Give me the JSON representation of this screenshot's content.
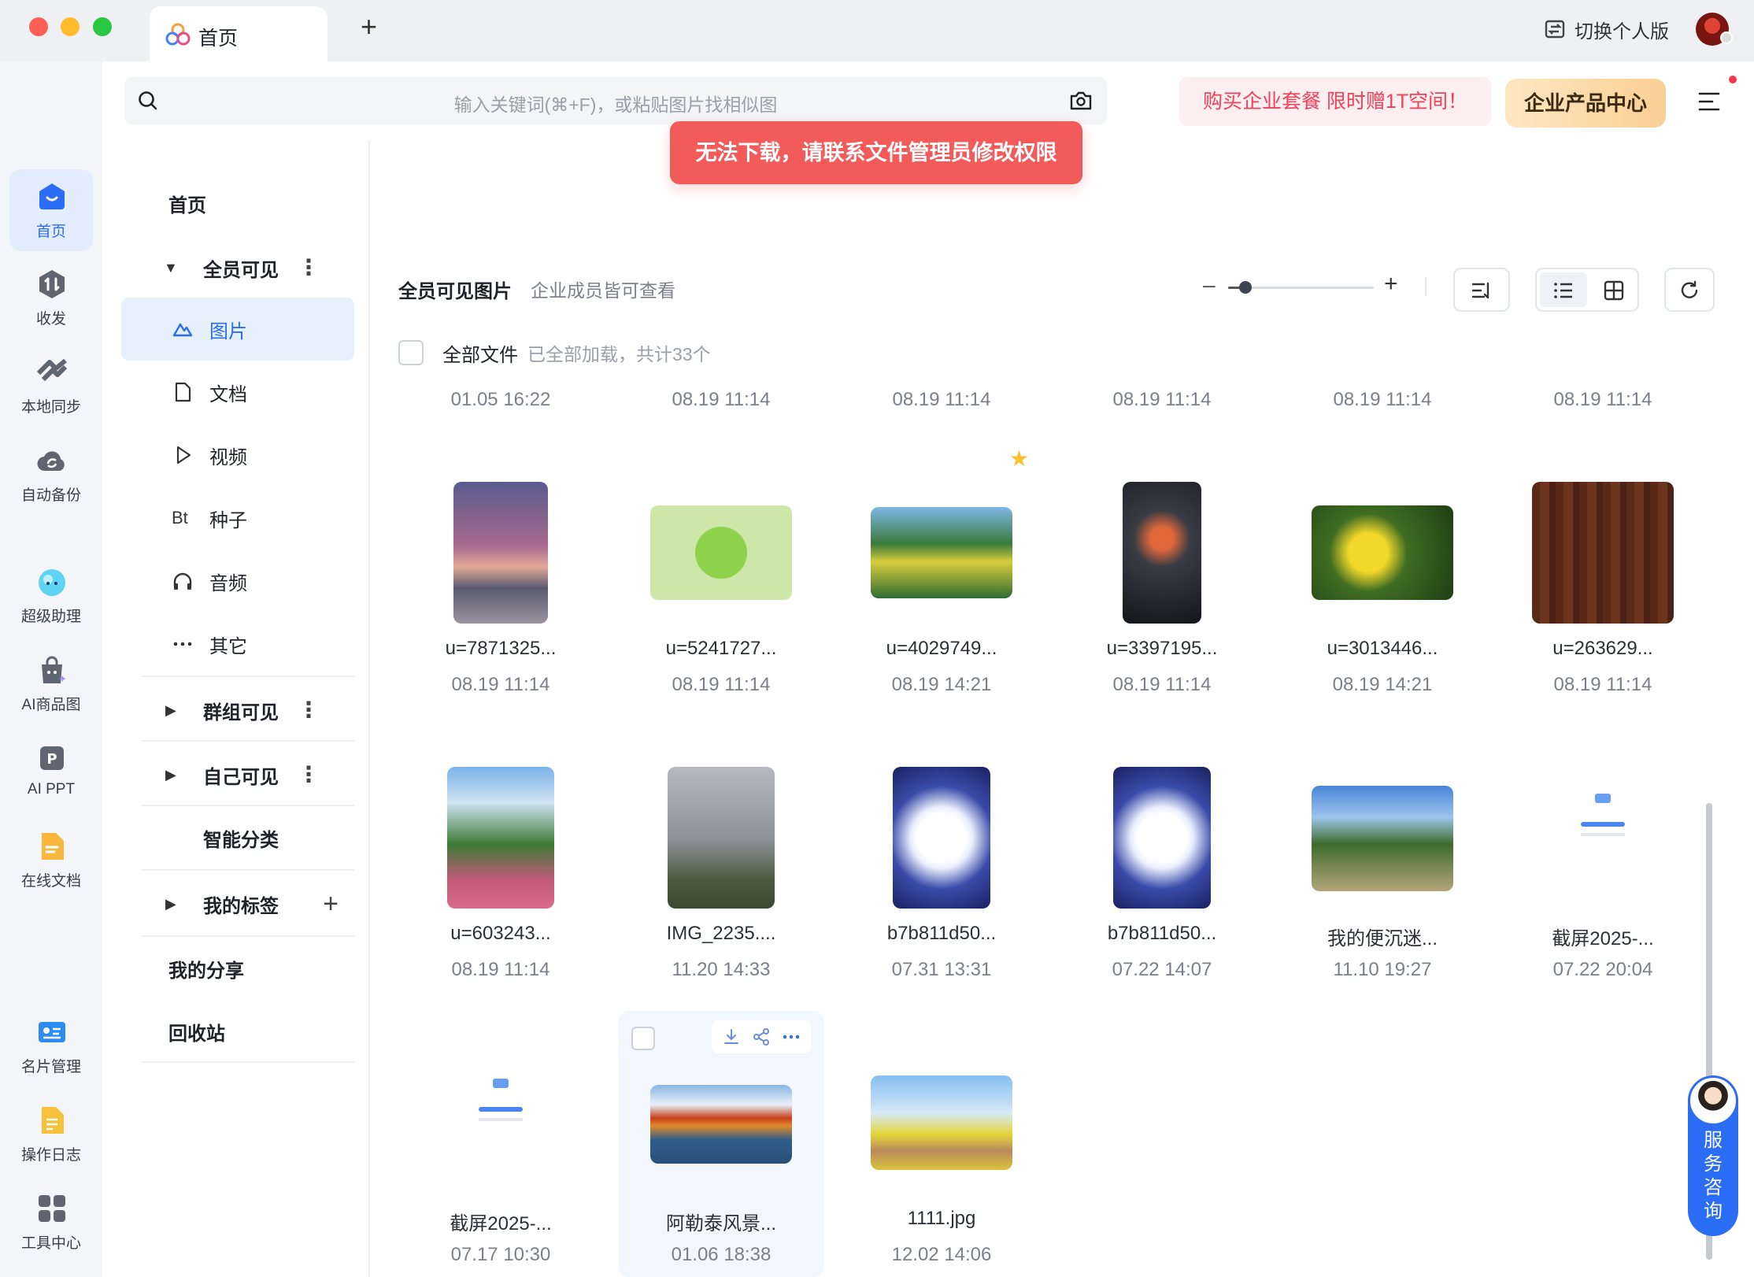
{
  "tab": {
    "label": "首页",
    "add": "+"
  },
  "titlebar": {
    "switch_label": "切换个人版"
  },
  "search": {
    "placeholder": "输入关键词(⌘+F)，或粘贴图片找相似图"
  },
  "promo": "购买企业套餐 限时赠1T空间！",
  "product_center": "企业产品中心",
  "toast": "无法下载，请联系文件管理员修改权限",
  "rail": [
    {
      "label": "首页",
      "icon": "home-icon"
    },
    {
      "label": "收发",
      "icon": "transfer-icon"
    },
    {
      "label": "本地同步",
      "icon": "sync-icon"
    },
    {
      "label": "自动备份",
      "icon": "backup-icon"
    },
    {
      "label": "超级助理",
      "icon": "assistant-icon"
    },
    {
      "label": "AI商品图",
      "icon": "ai-product-icon"
    },
    {
      "label": "AI PPT",
      "icon": "ai-ppt-icon"
    },
    {
      "label": "在线文档",
      "icon": "online-doc-icon"
    },
    {
      "label": "名片管理",
      "icon": "card-icon"
    },
    {
      "label": "操作日志",
      "icon": "log-icon"
    },
    {
      "label": "工具中心",
      "icon": "tools-icon"
    }
  ],
  "sidebar": {
    "home": "首页",
    "all_visible": "全员可见",
    "images": "图片",
    "docs": "文档",
    "videos": "视频",
    "torrent": "种子",
    "torrent_prefix": "Bt",
    "audio": "音频",
    "other": "其它",
    "group_visible": "群组可见",
    "self_visible": "自己可见",
    "smart": "智能分类",
    "tags": "我的标签",
    "shares": "我的分享",
    "trash": "回收站"
  },
  "content": {
    "title": "全员可见图片",
    "subtitle": "企业成员皆可查看",
    "all_files": "全部文件",
    "loaded": "已全部加载，共计33个",
    "zoom_level": 0.12
  },
  "top_dates": [
    "01.05 16:22",
    "08.19 11:14",
    "08.19 11:14",
    "08.19 11:14",
    "08.19 11:14",
    "08.19 11:14"
  ],
  "files": [
    {
      "name": "u=7871325...",
      "date": "08.19 11:14"
    },
    {
      "name": "u=5241727...",
      "date": "08.19 11:14"
    },
    {
      "name": "u=4029749...",
      "date": "08.19 14:21"
    },
    {
      "name": "u=3397195...",
      "date": "08.19 11:14"
    },
    {
      "name": "u=3013446...",
      "date": "08.19 14:21"
    },
    {
      "name": "u=263629...",
      "date": "08.19 11:14"
    },
    {
      "name": "u=603243...",
      "date": "08.19 11:14"
    },
    {
      "name": "IMG_2235....",
      "date": "11.20 14:33"
    },
    {
      "name": "b7b811d50...",
      "date": "07.31 13:31"
    },
    {
      "name": "b7b811d50...",
      "date": "07.22 14:07"
    },
    {
      "name": "我的便沉迷...",
      "date": "11.10 19:27"
    },
    {
      "name": "截屏2025-...",
      "date": "07.22 20:04"
    },
    {
      "name": "截屏2025-...",
      "date": "07.17 10:30"
    },
    {
      "name": "阿勒泰风景...",
      "date": "01.06 18:38"
    },
    {
      "name": "1111.jpg",
      "date": "12.02 14:06"
    }
  ],
  "service": "服务咨询"
}
